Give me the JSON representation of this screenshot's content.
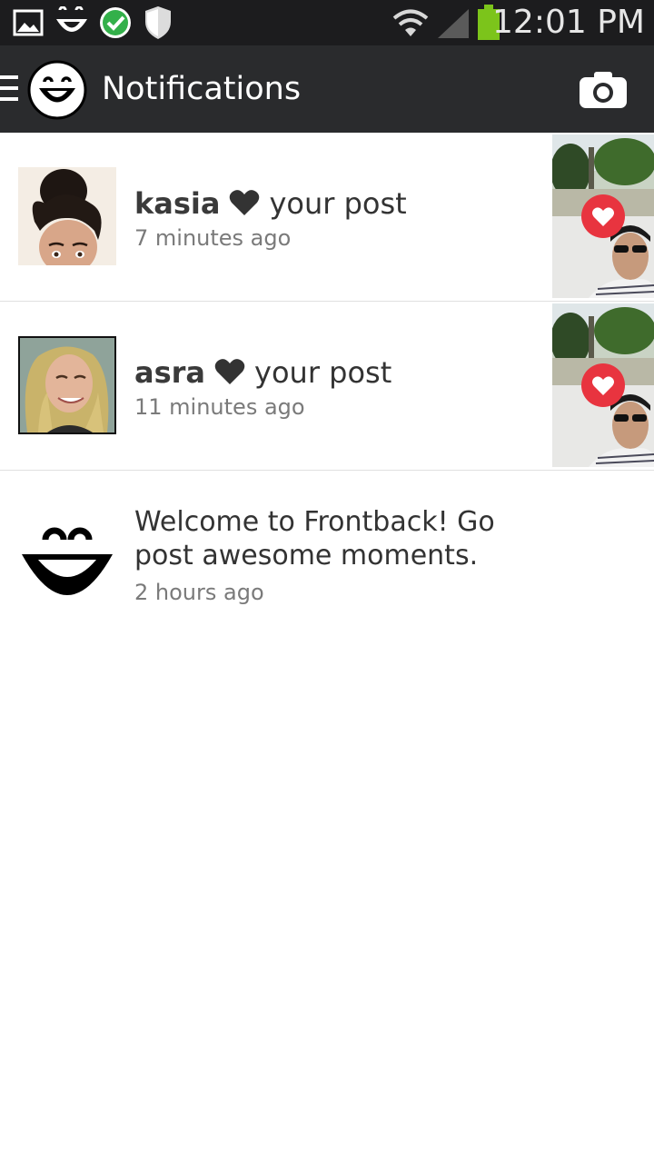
{
  "status_bar": {
    "time": "12:01 PM",
    "icons": [
      "gallery-icon",
      "frontback-icon",
      "check-circle-icon",
      "shield-icon",
      "wifi-icon",
      "signal-icon",
      "battery-icon"
    ]
  },
  "action_bar": {
    "title": "Notifications",
    "menu_icon": "hamburger-icon",
    "logo_icon": "frontback-logo-icon",
    "camera_icon": "camera-icon"
  },
  "notifications": [
    {
      "username": "kasia",
      "action": "your post",
      "time": "7 minutes ago",
      "icon": "heart-icon"
    },
    {
      "username": "asra",
      "action": "your post",
      "time": "11 minutes ago",
      "icon": "heart-icon"
    }
  ],
  "welcome": {
    "text": "Welcome to Frontback! Go post awesome moments.",
    "time": "2 hours ago",
    "icon": "frontback-smile-icon"
  },
  "colors": {
    "status_bar_bg": "#1c1c1e",
    "action_bar_bg": "#2a2b2d",
    "like_badge": "#e8343f",
    "battery": "#7cc41b"
  }
}
